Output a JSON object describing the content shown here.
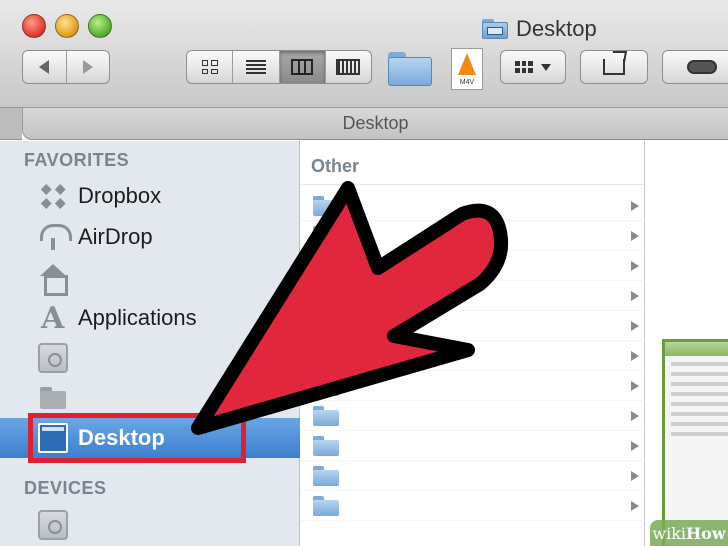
{
  "window": {
    "title": "Desktop",
    "path_label": "Desktop"
  },
  "toolbar": {
    "file_badge": "M4V"
  },
  "sidebar": {
    "favorites_header": "FAVORITES",
    "devices_header": "DEVICES",
    "items": [
      {
        "label": "Dropbox",
        "icon": "dropbox-icon"
      },
      {
        "label": "AirDrop",
        "icon": "airdrop-icon"
      },
      {
        "label": "",
        "icon": "home-icon"
      },
      {
        "label": "Applications",
        "icon": "applications-icon"
      },
      {
        "label": "",
        "icon": "disk-icon"
      },
      {
        "label": "",
        "icon": "folder-icon"
      },
      {
        "label": "Desktop",
        "icon": "desktop-icon",
        "selected": true
      }
    ]
  },
  "column": {
    "header": "Other",
    "row_count_visible": 11
  },
  "watermark": {
    "prefix": "wiki",
    "suffix": "How"
  },
  "colors": {
    "selection": "#3a7fd0",
    "highlight_box": "#e02030",
    "arrow_fill": "#e0273e",
    "arrow_outline": "#000000"
  }
}
